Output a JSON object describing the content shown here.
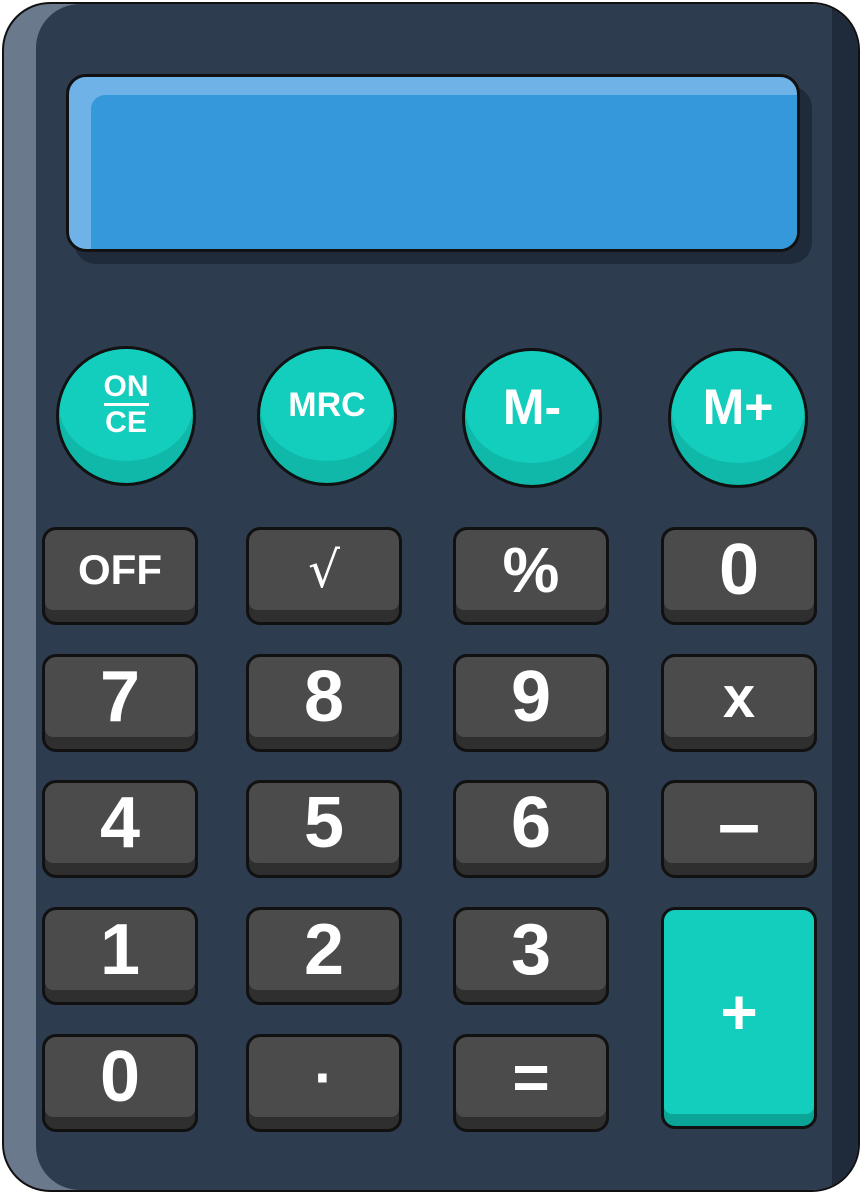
{
  "display": {
    "value": ""
  },
  "function_buttons": [
    {
      "name": "on-ce-button",
      "label_top": "ON",
      "label_bottom": "CE"
    },
    {
      "name": "mrc-button",
      "label": "MRC"
    },
    {
      "name": "m-minus-button",
      "label": "M-"
    },
    {
      "name": "m-plus-button",
      "label": "M+"
    }
  ],
  "keys": {
    "off": "OFF",
    "sqrt": "√",
    "percent": "%",
    "zero_top": "0",
    "seven": "7",
    "eight": "8",
    "nine": "9",
    "multiply": "x",
    "four": "4",
    "five": "5",
    "six": "6",
    "minus": "–",
    "one": "1",
    "two": "2",
    "three": "3",
    "plus": "+",
    "zero": "0",
    "decimal": "·",
    "equals": "="
  },
  "colors": {
    "body": "#2e3c50",
    "display": "#3598db",
    "accent": "#13cdbd",
    "key": "#4b4b4b"
  }
}
